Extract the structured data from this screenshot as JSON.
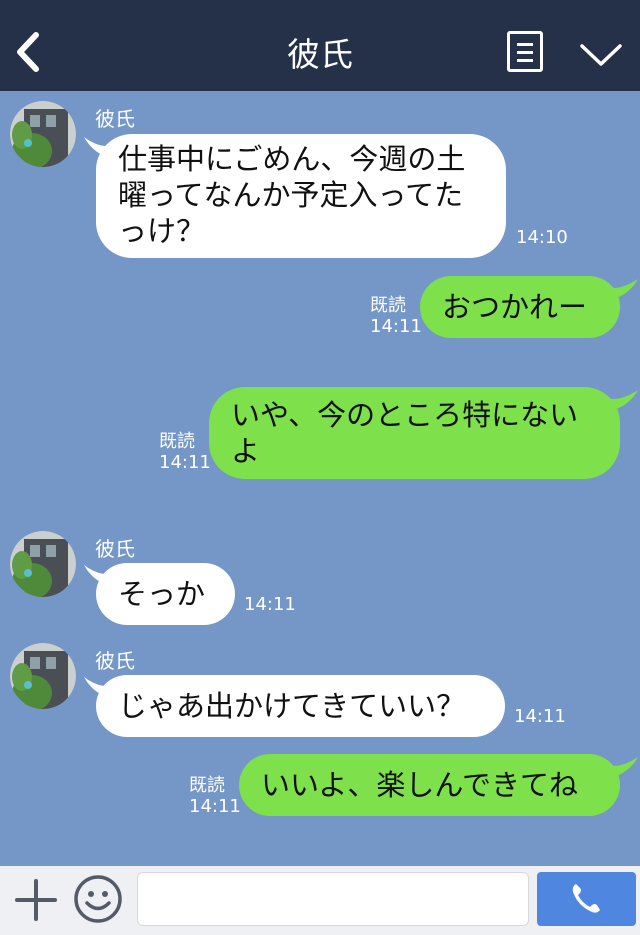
{
  "header": {
    "title": "彼氏",
    "back_icon": "back-chevron-icon",
    "menu_icon": "list-menu-icon",
    "collapse_icon": "chevron-down-icon"
  },
  "messages": [
    {
      "direction": "in",
      "sender": "彼氏",
      "lines": [
        "仕事中にごめん、今週の土",
        "曜ってなんか予定入ってた",
        "っけ？"
      ],
      "time": "14:10"
    },
    {
      "direction": "out",
      "read": "既読",
      "time": "14:11",
      "lines": [
        "おつかれー"
      ]
    },
    {
      "direction": "out",
      "read": "既読",
      "time": "14:11",
      "lines": [
        "いや、今のところ特にない",
        "よ"
      ]
    },
    {
      "direction": "in",
      "sender": "彼氏",
      "lines": [
        "そっか"
      ],
      "time": "14:11"
    },
    {
      "direction": "in",
      "sender": "彼氏",
      "lines": [
        "じゃあ出かけてきていい？"
      ],
      "time": "14:11"
    },
    {
      "direction": "out",
      "read": "既読",
      "time": "14:11",
      "lines": [
        "いいよ、楽しんできてね"
      ]
    }
  ],
  "input": {
    "placeholder": ""
  },
  "colors": {
    "header": "#253049",
    "chat_bg": "#7497c8",
    "outgoing": "#7ee04a",
    "incoming": "#ffffff",
    "call": "#4f86e0"
  },
  "icons": {
    "plus": "plus-icon",
    "emoji": "smiley-icon",
    "call": "phone-icon"
  }
}
